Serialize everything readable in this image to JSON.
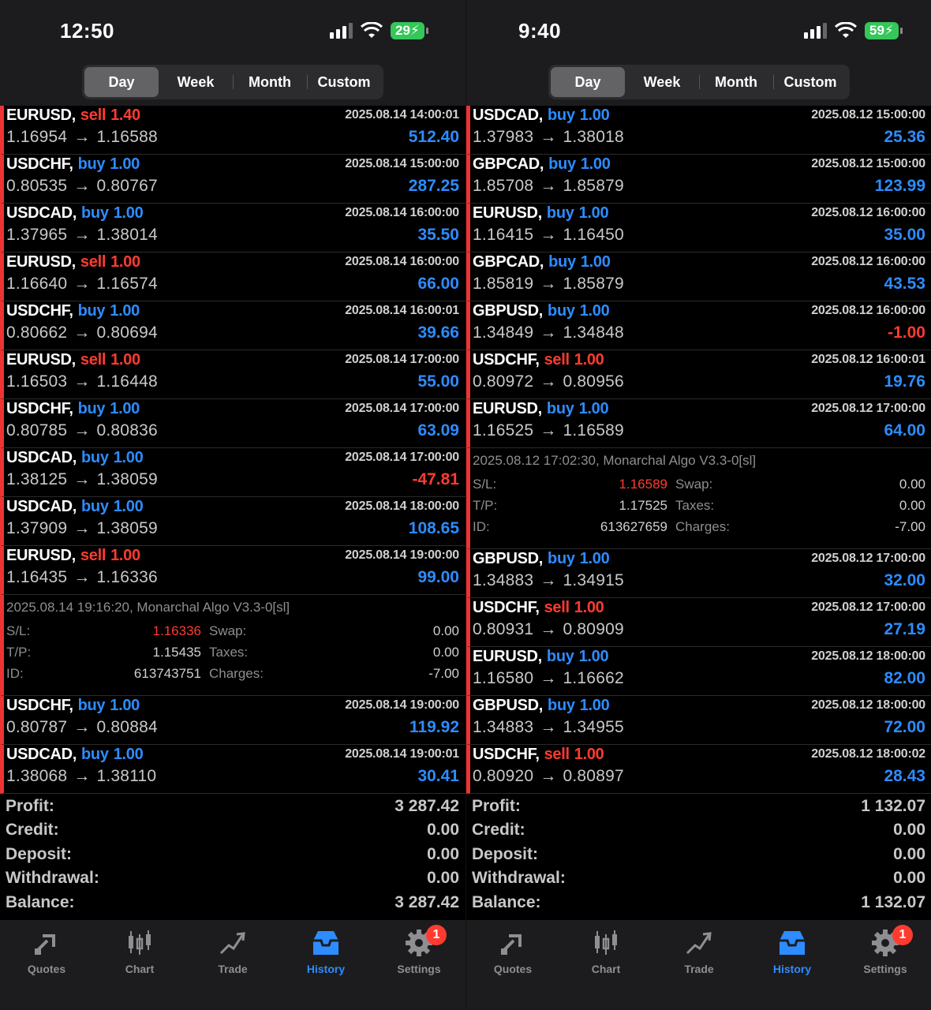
{
  "arrow": "→",
  "left": {
    "clock": "12:50",
    "battery": "29",
    "tabs": [
      "Day",
      "Week",
      "Month",
      "Custom"
    ],
    "deals": [
      {
        "symbol": "EURUSD,",
        "side": "sell",
        "volume": "1.40",
        "time": "2025.08.14 14:00:01",
        "open": "1.16954",
        "close": "1.16588",
        "profit": "512.40"
      },
      {
        "symbol": "USDCHF,",
        "side": "buy",
        "volume": "1.00",
        "time": "2025.08.14 15:00:00",
        "open": "0.80535",
        "close": "0.80767",
        "profit": "287.25"
      },
      {
        "symbol": "USDCAD,",
        "side": "buy",
        "volume": "1.00",
        "time": "2025.08.14 16:00:00",
        "open": "1.37965",
        "close": "1.38014",
        "profit": "35.50"
      },
      {
        "symbol": "EURUSD,",
        "side": "sell",
        "volume": "1.00",
        "time": "2025.08.14 16:00:00",
        "open": "1.16640",
        "close": "1.16574",
        "profit": "66.00"
      },
      {
        "symbol": "USDCHF,",
        "side": "buy",
        "volume": "1.00",
        "time": "2025.08.14 16:00:01",
        "open": "0.80662",
        "close": "0.80694",
        "profit": "39.66"
      },
      {
        "symbol": "EURUSD,",
        "side": "sell",
        "volume": "1.00",
        "time": "2025.08.14 17:00:00",
        "open": "1.16503",
        "close": "1.16448",
        "profit": "55.00"
      },
      {
        "symbol": "USDCHF,",
        "side": "buy",
        "volume": "1.00",
        "time": "2025.08.14 17:00:00",
        "open": "0.80785",
        "close": "0.80836",
        "profit": "63.09"
      },
      {
        "symbol": "USDCAD,",
        "side": "buy",
        "volume": "1.00",
        "time": "2025.08.14 17:00:00",
        "open": "1.38125",
        "close": "1.38059",
        "profit": "-47.81"
      },
      {
        "symbol": "USDCAD,",
        "side": "buy",
        "volume": "1.00",
        "time": "2025.08.14 18:00:00",
        "open": "1.37909",
        "close": "1.38059",
        "profit": "108.65"
      },
      {
        "symbol": "EURUSD,",
        "side": "sell",
        "volume": "1.00",
        "time": "2025.08.14 19:00:00",
        "open": "1.16435",
        "close": "1.16336",
        "profit": "99.00"
      },
      {
        "symbol": "USDCHF,",
        "side": "buy",
        "volume": "1.00",
        "time": "2025.08.14 19:00:00",
        "open": "0.80787",
        "close": "0.80884",
        "profit": "119.92"
      },
      {
        "symbol": "USDCAD,",
        "side": "buy",
        "volume": "1.00",
        "time": "2025.08.14 19:00:01",
        "open": "1.38068",
        "close": "1.38110",
        "profit": "30.41"
      }
    ],
    "detail": {
      "after_index": 9,
      "comment": "2025.08.14 19:16:20, Monarchal Algo V3.3-0[sl]",
      "sl_label": "S/L:",
      "sl": "1.16336",
      "tp_label": "T/P:",
      "tp": "1.15435",
      "id_label": "ID:",
      "id": "613743751",
      "swap_label": "Swap:",
      "swap": "0.00",
      "taxes_label": "Taxes:",
      "taxes": "0.00",
      "charges_label": "Charges:",
      "charges": "-7.00"
    },
    "summary": [
      {
        "label": "Profit:",
        "value": "3 287.42"
      },
      {
        "label": "Credit:",
        "value": "0.00"
      },
      {
        "label": "Deposit:",
        "value": "0.00"
      },
      {
        "label": "Withdrawal:",
        "value": "0.00"
      },
      {
        "label": "Balance:",
        "value": "3 287.42"
      }
    ]
  },
  "right": {
    "clock": "9:40",
    "battery": "59",
    "tabs": [
      "Day",
      "Week",
      "Month",
      "Custom"
    ],
    "deals": [
      {
        "symbol": "USDCAD,",
        "side": "buy",
        "volume": "1.00",
        "time": "2025.08.12 15:00:00",
        "open": "1.37983",
        "close": "1.38018",
        "profit": "25.36"
      },
      {
        "symbol": "GBPCAD,",
        "side": "buy",
        "volume": "1.00",
        "time": "2025.08.12 15:00:00",
        "open": "1.85708",
        "close": "1.85879",
        "profit": "123.99"
      },
      {
        "symbol": "EURUSD,",
        "side": "buy",
        "volume": "1.00",
        "time": "2025.08.12 16:00:00",
        "open": "1.16415",
        "close": "1.16450",
        "profit": "35.00"
      },
      {
        "symbol": "GBPCAD,",
        "side": "buy",
        "volume": "1.00",
        "time": "2025.08.12 16:00:00",
        "open": "1.85819",
        "close": "1.85879",
        "profit": "43.53"
      },
      {
        "symbol": "GBPUSD,",
        "side": "buy",
        "volume": "1.00",
        "time": "2025.08.12 16:00:00",
        "open": "1.34849",
        "close": "1.34848",
        "profit": "-1.00"
      },
      {
        "symbol": "USDCHF,",
        "side": "sell",
        "volume": "1.00",
        "time": "2025.08.12 16:00:01",
        "open": "0.80972",
        "close": "0.80956",
        "profit": "19.76"
      },
      {
        "symbol": "EURUSD,",
        "side": "buy",
        "volume": "1.00",
        "time": "2025.08.12 17:00:00",
        "open": "1.16525",
        "close": "1.16589",
        "profit": "64.00"
      },
      {
        "symbol": "GBPUSD,",
        "side": "buy",
        "volume": "1.00",
        "time": "2025.08.12 17:00:00",
        "open": "1.34883",
        "close": "1.34915",
        "profit": "32.00"
      },
      {
        "symbol": "USDCHF,",
        "side": "sell",
        "volume": "1.00",
        "time": "2025.08.12 17:00:00",
        "open": "0.80931",
        "close": "0.80909",
        "profit": "27.19"
      },
      {
        "symbol": "EURUSD,",
        "side": "buy",
        "volume": "1.00",
        "time": "2025.08.12 18:00:00",
        "open": "1.16580",
        "close": "1.16662",
        "profit": "82.00"
      },
      {
        "symbol": "GBPUSD,",
        "side": "buy",
        "volume": "1.00",
        "time": "2025.08.12 18:00:00",
        "open": "1.34883",
        "close": "1.34955",
        "profit": "72.00"
      },
      {
        "symbol": "USDCHF,",
        "side": "sell",
        "volume": "1.00",
        "time": "2025.08.12 18:00:02",
        "open": "0.80920",
        "close": "0.80897",
        "profit": "28.43"
      }
    ],
    "detail": {
      "after_index": 6,
      "comment": "2025.08.12 17:02:30, Monarchal Algo V3.3-0[sl]",
      "sl_label": "S/L:",
      "sl": "1.16589",
      "tp_label": "T/P:",
      "tp": "1.17525",
      "id_label": "ID:",
      "id": "613627659",
      "swap_label": "Swap:",
      "swap": "0.00",
      "taxes_label": "Taxes:",
      "taxes": "0.00",
      "charges_label": "Charges:",
      "charges": "-7.00"
    },
    "summary": [
      {
        "label": "Profit:",
        "value": "1 132.07"
      },
      {
        "label": "Credit:",
        "value": "0.00"
      },
      {
        "label": "Deposit:",
        "value": "0.00"
      },
      {
        "label": "Withdrawal:",
        "value": "0.00"
      },
      {
        "label": "Balance:",
        "value": "1 132.07"
      }
    ]
  },
  "tabbar": {
    "items": [
      {
        "label": "Quotes",
        "icon": "quotes-icon"
      },
      {
        "label": "Chart",
        "icon": "chart-icon"
      },
      {
        "label": "Trade",
        "icon": "trade-icon"
      },
      {
        "label": "History",
        "icon": "history-icon",
        "active": true
      },
      {
        "label": "Settings",
        "icon": "settings-icon",
        "badge": "1"
      }
    ]
  },
  "colors": {
    "buy": "#2d8cff",
    "sell": "#ff3b30",
    "accent": "#2d8cff",
    "battery": "#34c759"
  }
}
